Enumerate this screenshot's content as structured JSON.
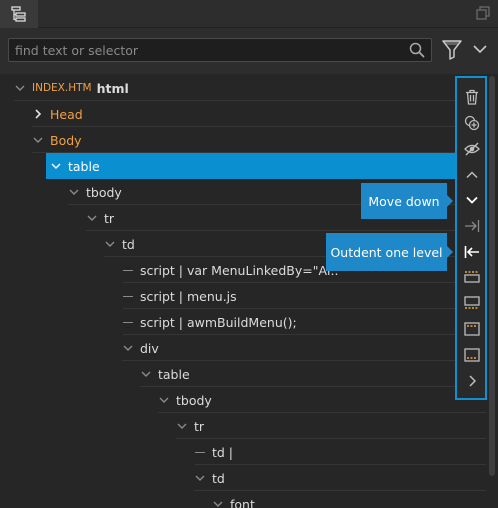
{
  "search": {
    "placeholder": "find text or selector"
  },
  "tree": {
    "rows": [
      {
        "file": "INDEX.HTM",
        "text": "html"
      },
      {
        "text": "Head"
      },
      {
        "text": "Body"
      },
      {
        "text": "table"
      },
      {
        "text": "tbody"
      },
      {
        "text": "tr"
      },
      {
        "text": "td"
      },
      {
        "text": "script | var MenuLinkedBy=\"Al.."
      },
      {
        "text": "script | menu.js"
      },
      {
        "text": "script | awmBuildMenu();"
      },
      {
        "text": "div"
      },
      {
        "text": "table"
      },
      {
        "text": "tbody"
      },
      {
        "text": "tr"
      },
      {
        "text": "td |"
      },
      {
        "text": "td"
      },
      {
        "text": "font"
      }
    ]
  },
  "toolbar": {
    "tooltip_move_down": "Move down",
    "tooltip_outdent": "Outdent one level"
  },
  "icons": {
    "dom-tab": "dom-tree-icon",
    "popout": "popout-icon",
    "search": "search-icon",
    "filter": "filter-icon",
    "filter_chevron": "chevron-down-icon",
    "toolbar": [
      "delete-icon",
      "duplicate-icon",
      "hide-icon",
      "move-up-icon",
      "move-down-icon",
      "indent-icon",
      "outdent-icon",
      "insert-before-icon",
      "insert-wrap-icon",
      "insert-after-icon",
      "insert-inside-first-icon",
      "insert-inside-last-icon",
      "more-icon"
    ]
  },
  "colors": {
    "selection": "#0a8fd0",
    "accent": "#0e90d2",
    "orange": "#f0a145",
    "tooltip": "#1e88c8"
  }
}
